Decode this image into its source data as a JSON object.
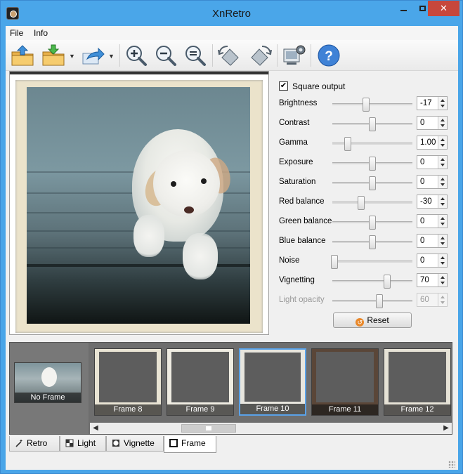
{
  "window": {
    "title": "XnRetro"
  },
  "menu": [
    "File",
    "Info"
  ],
  "toolbar": {
    "icons": [
      "open-folder-icon",
      "save-icon",
      "share-icon",
      "zoom-in-icon",
      "zoom-out-icon",
      "zoom-fit-icon",
      "rotate-left-icon",
      "rotate-right-icon",
      "screen-capture-icon",
      "help-icon"
    ]
  },
  "controls": {
    "square_output": {
      "label": "Square output",
      "checked": true
    },
    "rows": [
      {
        "label": "Brightness",
        "value": "-17",
        "pos": 0.42,
        "disabled": false
      },
      {
        "label": "Contrast",
        "value": "0",
        "pos": 0.5,
        "disabled": false
      },
      {
        "label": "Gamma",
        "value": "1.00",
        "pos": 0.19,
        "disabled": false
      },
      {
        "label": "Exposure",
        "value": "0",
        "pos": 0.5,
        "disabled": false
      },
      {
        "label": "Saturation",
        "value": "0",
        "pos": 0.5,
        "disabled": false
      },
      {
        "label": "Red balance",
        "value": "-30",
        "pos": 0.36,
        "disabled": false
      },
      {
        "label": "Green balance",
        "value": "0",
        "pos": 0.5,
        "disabled": false
      },
      {
        "label": "Blue balance",
        "value": "0",
        "pos": 0.5,
        "disabled": false
      },
      {
        "label": "Noise",
        "value": "0",
        "pos": 0.03,
        "disabled": false
      },
      {
        "label": "Vignetting",
        "value": "70",
        "pos": 0.68,
        "disabled": false
      },
      {
        "label": "Light opacity",
        "value": "60",
        "pos": 0.59,
        "disabled": true
      }
    ],
    "reset_label": "Reset"
  },
  "gallery": {
    "no_frame_label": "No Frame",
    "frames": [
      {
        "label": "Frame 8",
        "selected": false,
        "border": "#e9e4d4"
      },
      {
        "label": "Frame 9",
        "selected": false,
        "border": "#efece2"
      },
      {
        "label": "Frame 10",
        "selected": true,
        "border": "#e8e6de"
      },
      {
        "label": "Frame 11",
        "selected": false,
        "border": "#5a4638"
      },
      {
        "label": "Frame 12",
        "selected": false,
        "border": "#e6e2d6"
      }
    ]
  },
  "tabs": [
    {
      "label": "Retro",
      "icon": "wand-icon",
      "active": false
    },
    {
      "label": "Light",
      "icon": "light-icon",
      "active": false
    },
    {
      "label": "Vignette",
      "icon": "vignette-icon",
      "active": false
    },
    {
      "label": "Frame",
      "icon": "frame-icon",
      "active": true
    }
  ],
  "colors": {
    "titlebar": "#4aa6e9",
    "close": "#c7473c",
    "selection": "#5aa2e8"
  }
}
